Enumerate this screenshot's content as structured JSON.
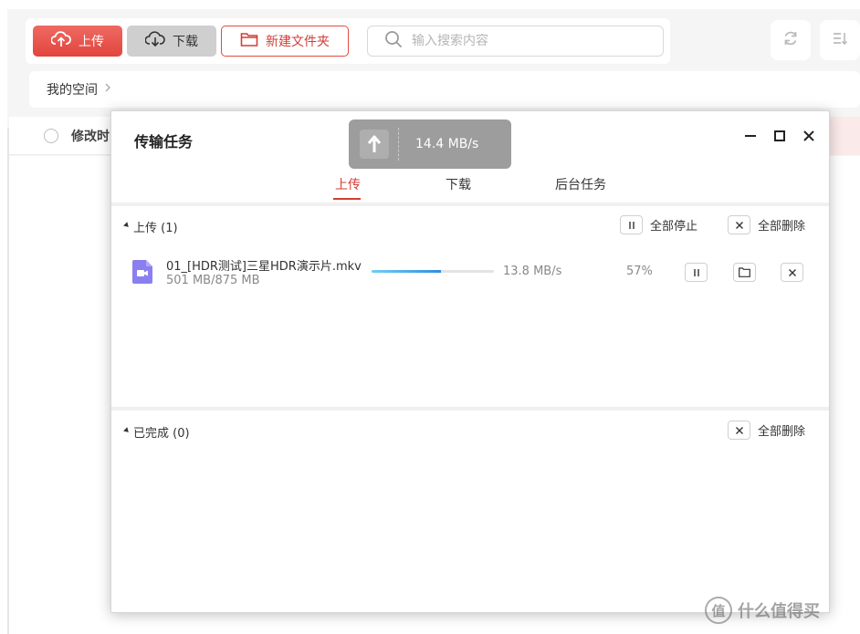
{
  "toolbar": {
    "upload_label": "上传",
    "download_label": "下载",
    "new_folder_label": "新建文件夹",
    "search_placeholder": "输入搜索内容"
  },
  "breadcrumb": {
    "root": "我的空间"
  },
  "list": {
    "header_modified": "修改时"
  },
  "dialog": {
    "title": "传输任务",
    "tabs": [
      {
        "label": "上传",
        "active": true
      },
      {
        "label": "下载",
        "active": false
      },
      {
        "label": "后台任务",
        "active": false
      }
    ],
    "upload_section": {
      "title": "上传 (1)",
      "pause_all_label": "全部停止",
      "delete_all_label": "全部删除"
    },
    "task": {
      "file_name": "01_[HDR测试]三星HDR演示片.mkv",
      "size_text": "501 MB/875 MB",
      "speed": "13.8 MB/s",
      "percent": "57%",
      "progress_fraction": 0.57,
      "file_icon": "video-file-icon"
    },
    "completed_section": {
      "title": "已完成 (0)",
      "delete_all_label": "全部删除"
    }
  },
  "speed_overlay": {
    "speed": "14.4 MB/s",
    "icon": "upload-arrow-icon"
  },
  "watermark": {
    "text": "什么值得买",
    "logo_char": "值"
  },
  "colors": {
    "accent": "#d43d35",
    "progress_start": "#6fd0f2",
    "progress_end": "#2f8fe0",
    "video_icon": "#8b7ff0"
  }
}
